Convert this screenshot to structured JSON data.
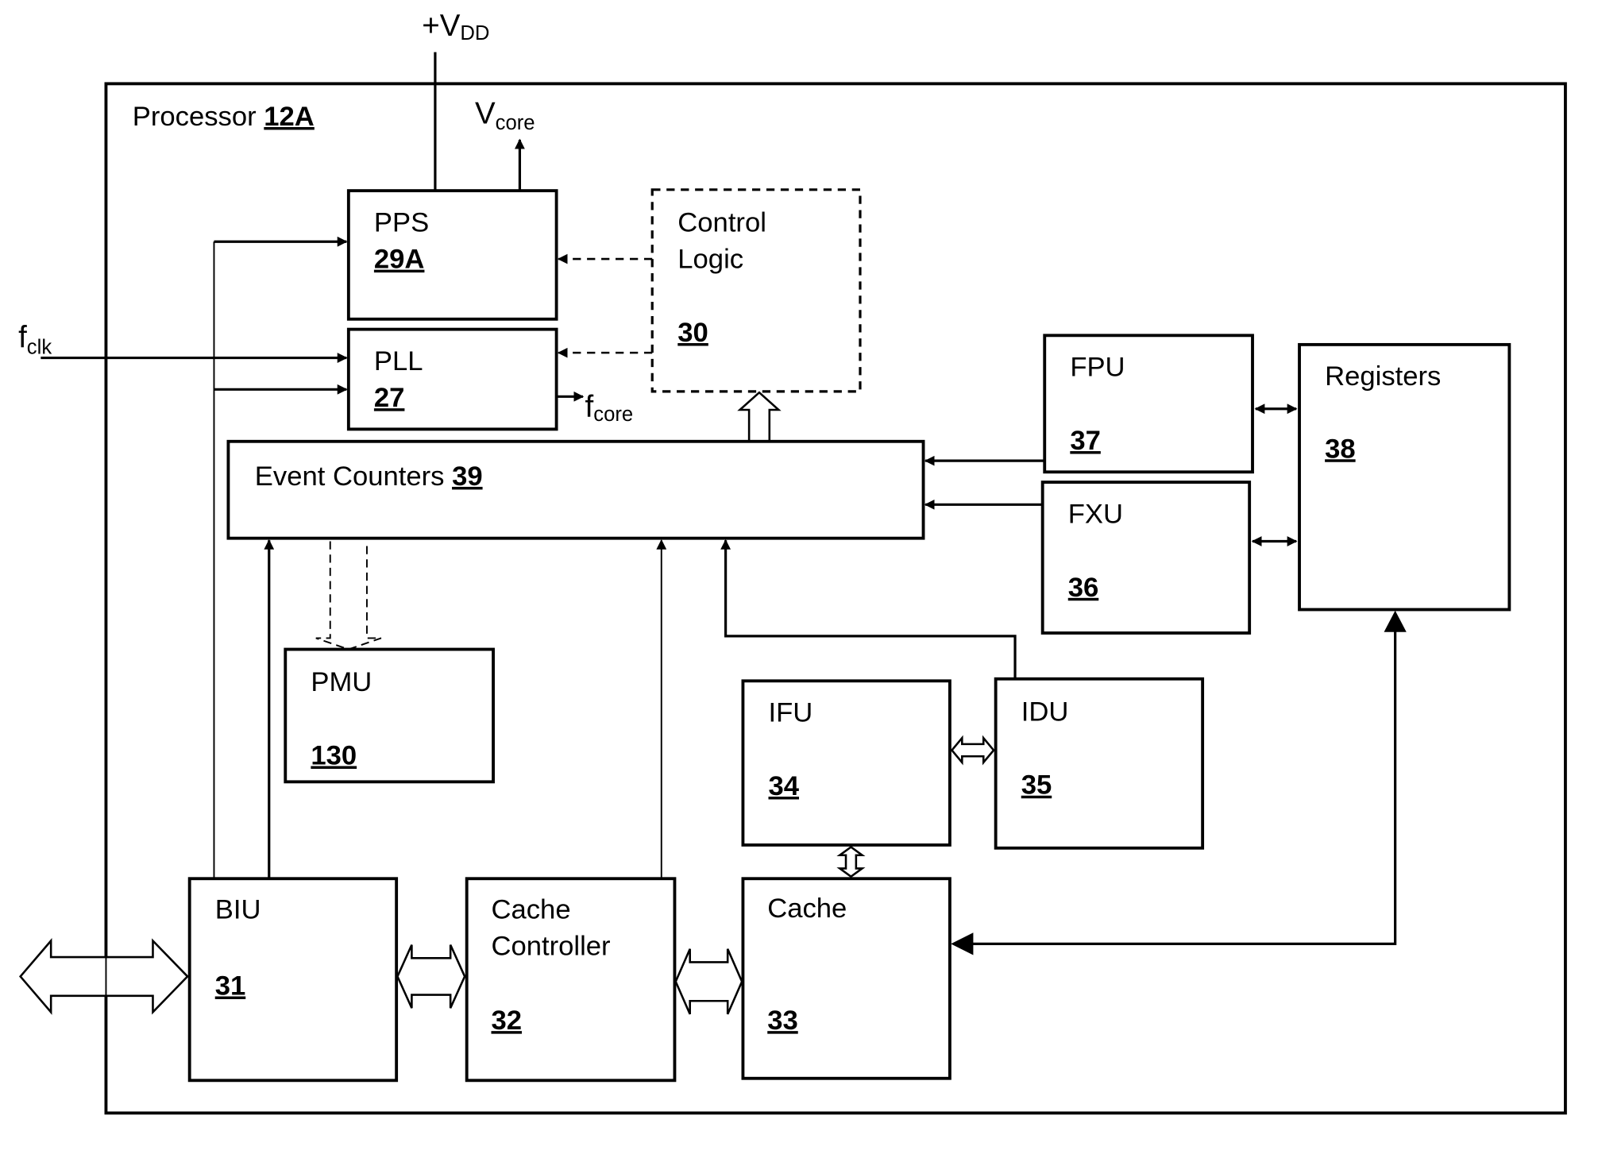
{
  "diagram": {
    "supply": {
      "main": "+V",
      "sub": "DD"
    },
    "vcore": {
      "main": "V",
      "sub": "core"
    },
    "fclk": {
      "main": "f",
      "sub": "clk"
    },
    "fcore": {
      "main": "f",
      "sub": "core"
    },
    "processor": {
      "label": "Processor",
      "number": "12A"
    },
    "blocks": {
      "pps": {
        "label": "PPS",
        "number": "29A"
      },
      "pll": {
        "label": "PLL",
        "number": "27"
      },
      "control_logic": {
        "line1": "Control",
        "line2": "Logic",
        "number": "30"
      },
      "event_counters": {
        "label": "Event Counters",
        "number": "39"
      },
      "fpu": {
        "label": "FPU",
        "number": "37"
      },
      "fxu": {
        "label": "FXU",
        "number": "36"
      },
      "registers": {
        "label": "Registers",
        "number": "38"
      },
      "pmu": {
        "label": "PMU",
        "number": "130"
      },
      "ifu": {
        "label": "IFU",
        "number": "34"
      },
      "idu": {
        "label": "IDU",
        "number": "35"
      },
      "biu": {
        "label": "BIU",
        "number": "31"
      },
      "cache_controller": {
        "line1": "Cache",
        "line2": "Controller",
        "number": "32"
      },
      "cache": {
        "label": "Cache",
        "number": "33"
      }
    }
  }
}
